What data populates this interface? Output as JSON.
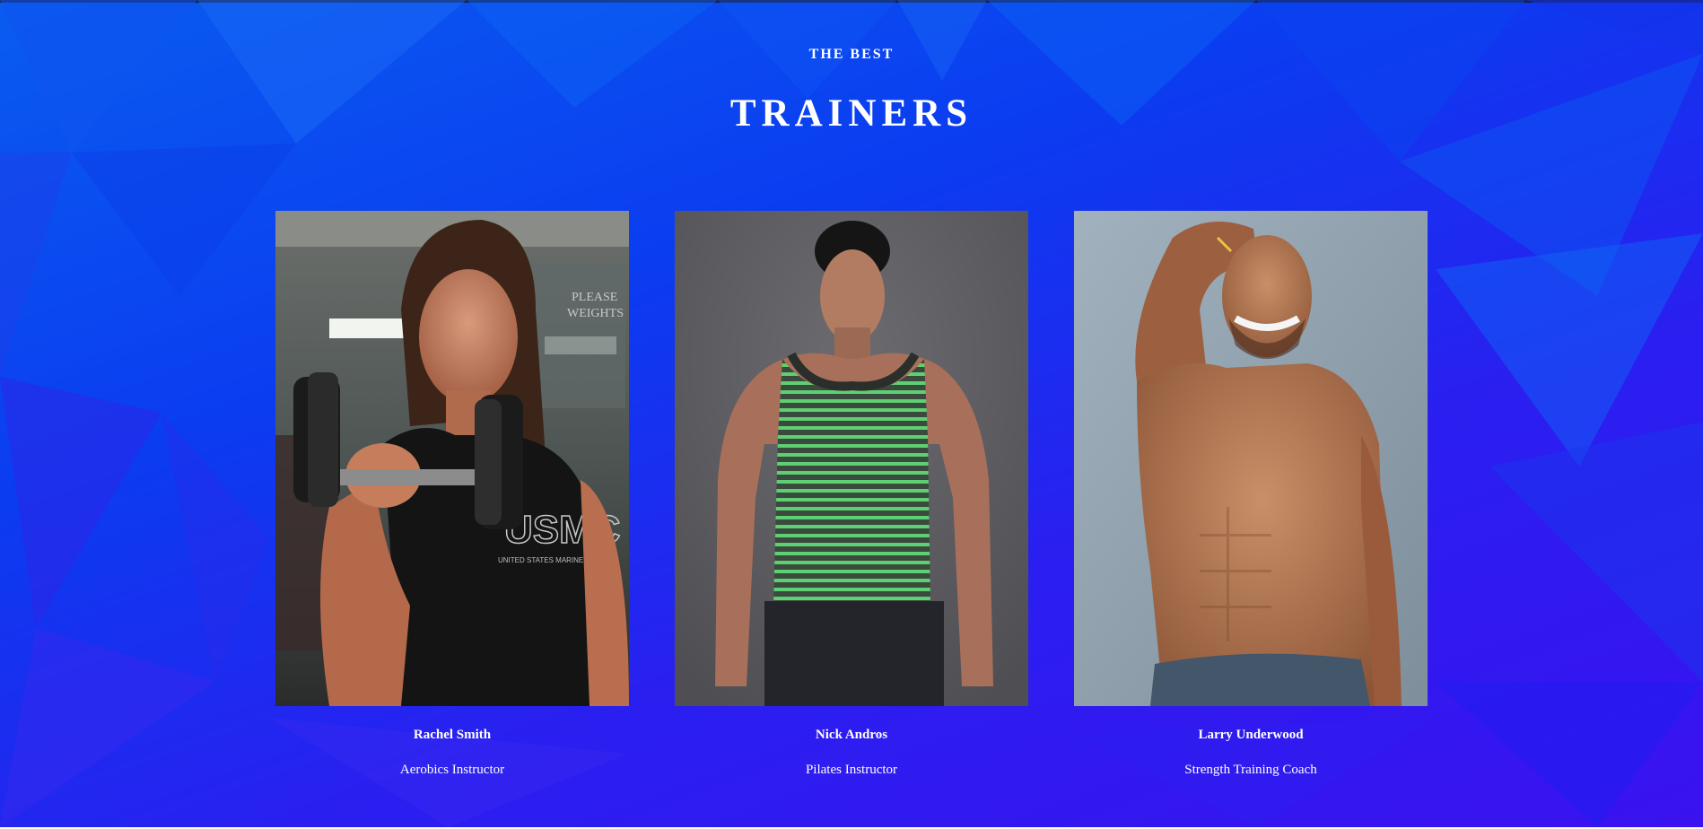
{
  "section": {
    "eyebrow": "THE BEST",
    "title": "TRAINERS"
  },
  "trainers": [
    {
      "name": "Rachel Smith",
      "role": "Aerobics Instructor"
    },
    {
      "name": "Nick Andros",
      "role": "Pilates Instructor"
    },
    {
      "name": "Larry Underwood",
      "role": "Strength Training Coach"
    }
  ],
  "photo_text": {
    "shirt_logo": "USMC",
    "shirt_sub": "UNITED STATES MARINE CORPS",
    "sign_line1": "PLEASE",
    "sign_line2": "WEIGHTS"
  },
  "colors": {
    "background_top": "#0a5cf0",
    "background_bottom": "#3a12f0",
    "text": "#ffffff"
  }
}
